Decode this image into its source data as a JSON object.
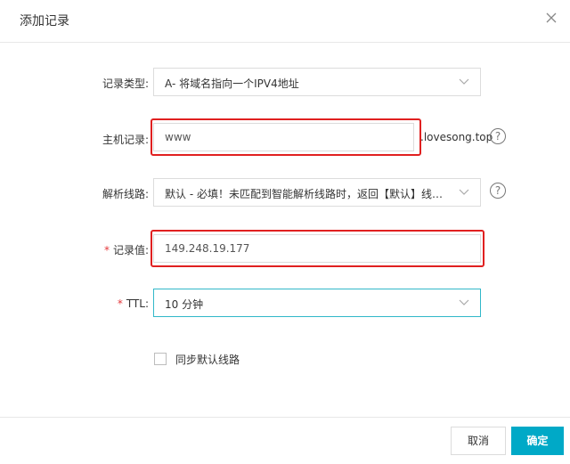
{
  "dialog": {
    "title": "添加记录",
    "close_icon": "close-icon"
  },
  "form": {
    "record_type": {
      "label": "记录类型:",
      "value": "A- 将域名指向一个IPV4地址"
    },
    "host": {
      "label": "主机记录:",
      "value": "www",
      "suffix": ".lovesong.top"
    },
    "line": {
      "label": "解析线路:",
      "value": "默认 - 必填！未匹配到智能解析线路时，返回【默认】线路..."
    },
    "record_value": {
      "required_mark": "*",
      "label": "记录值:",
      "value": "149.248.19.177"
    },
    "ttl": {
      "required_mark": "*",
      "label": "TTL:",
      "value": "10 分钟"
    },
    "sync": {
      "label": "同步默认线路",
      "checked": false
    },
    "help_glyph": "?"
  },
  "footer": {
    "cancel_label": "取消",
    "ok_label": "确定"
  },
  "colors": {
    "accent": "#00a9c7",
    "focus_border": "#31b8c9",
    "required": "#e4393c",
    "annotation": "#e02020"
  }
}
